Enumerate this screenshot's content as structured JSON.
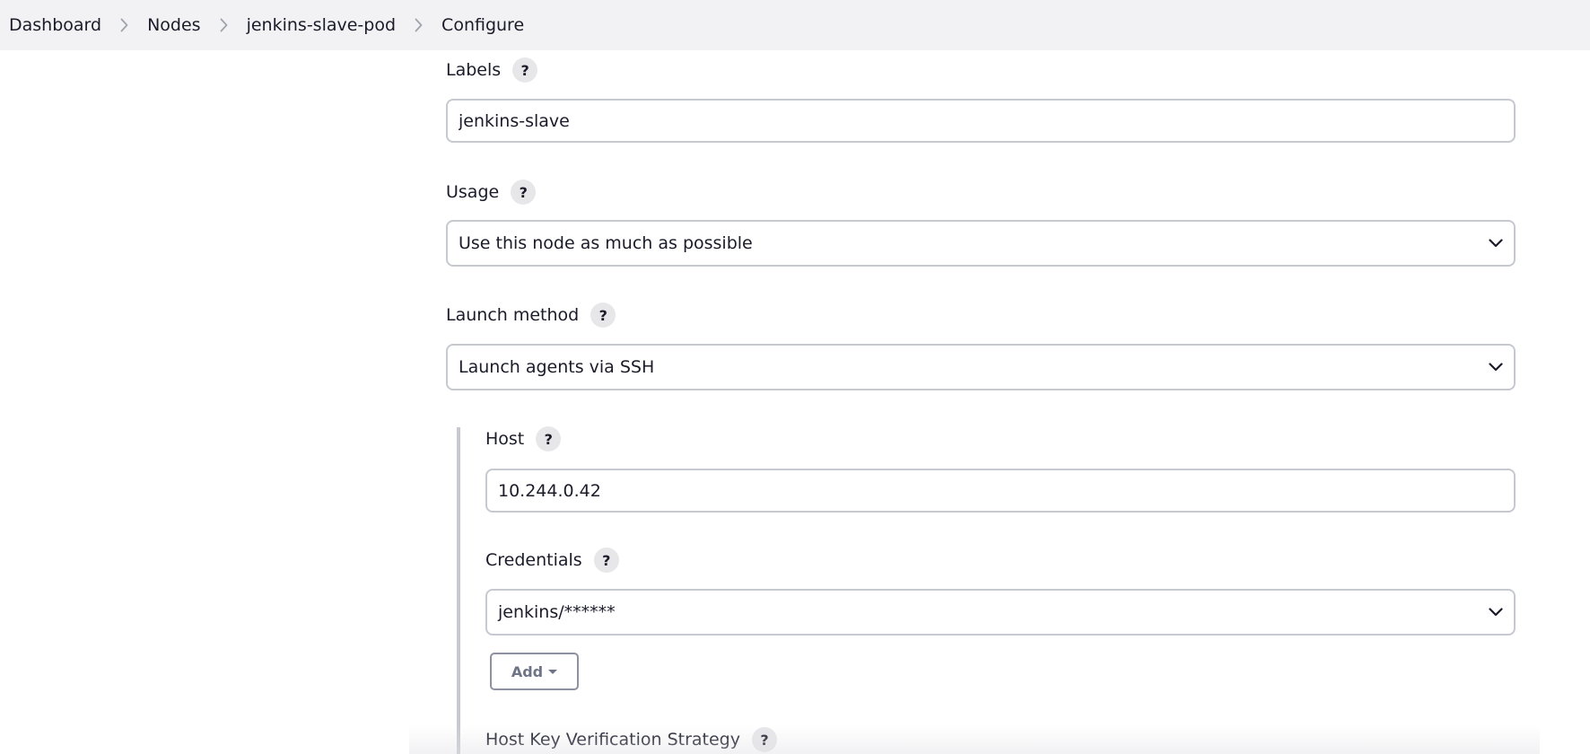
{
  "breadcrumb": {
    "items": [
      "Dashboard",
      "Nodes",
      "jenkins-slave-pod",
      "Configure"
    ]
  },
  "form": {
    "labels": {
      "label": "Labels",
      "value": "jenkins-slave",
      "help": "?"
    },
    "usage": {
      "label": "Usage",
      "value": "Use this node as much as possible",
      "help": "?"
    },
    "launch_method": {
      "label": "Launch method",
      "value": "Launch agents via SSH",
      "help": "?"
    },
    "host": {
      "label": "Host",
      "value": "10.244.0.42",
      "help": "?"
    },
    "credentials": {
      "label": "Credentials",
      "value": "jenkins/******",
      "help": "?"
    },
    "add_button": {
      "label": "Add"
    },
    "host_key_strategy": {
      "label": "Host Key Verification Strategy",
      "help": "?"
    }
  },
  "icons": {
    "chevron": "chevron-down-icon",
    "separator": "chevron-right-icon"
  },
  "colors": {
    "breadcrumb_bg": "#f2f2f4",
    "input_border": "#c6c9cf",
    "help_bg": "#e7e7ea",
    "text": "#1b1b2a",
    "button_text": "#6e7386"
  }
}
